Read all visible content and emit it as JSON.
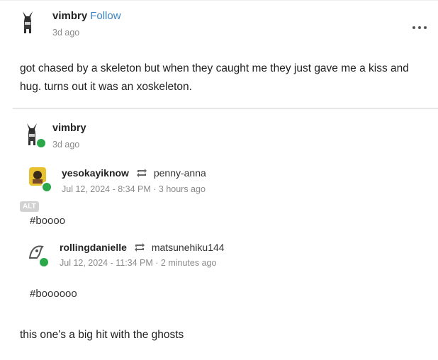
{
  "post": {
    "author": "vimbry",
    "follow_label": "Follow",
    "time": "3d ago",
    "more_icon": "more-icon",
    "body": "got chased by a skeleton but when they caught me they just gave me a kiss and hug. turns out it was an xoskeleton."
  },
  "reblog": {
    "author": "vimbry",
    "time": "3d ago",
    "replies": [
      {
        "user": "yesokayiknow",
        "source": "penny-anna",
        "date": "Jul 12, 2024 - 8:34 PM",
        "relative": "3 hours ago",
        "alt_badge": "ALT",
        "tag": "#boooo"
      },
      {
        "user": "rollingdanielle",
        "source": "matsunehiku144",
        "date": "Jul 12, 2024 - 11:34 PM",
        "relative": "2 minutes ago",
        "tag": "#boooooo"
      }
    ],
    "closing": "this one's a big hit with the ghosts"
  },
  "separator": " · "
}
